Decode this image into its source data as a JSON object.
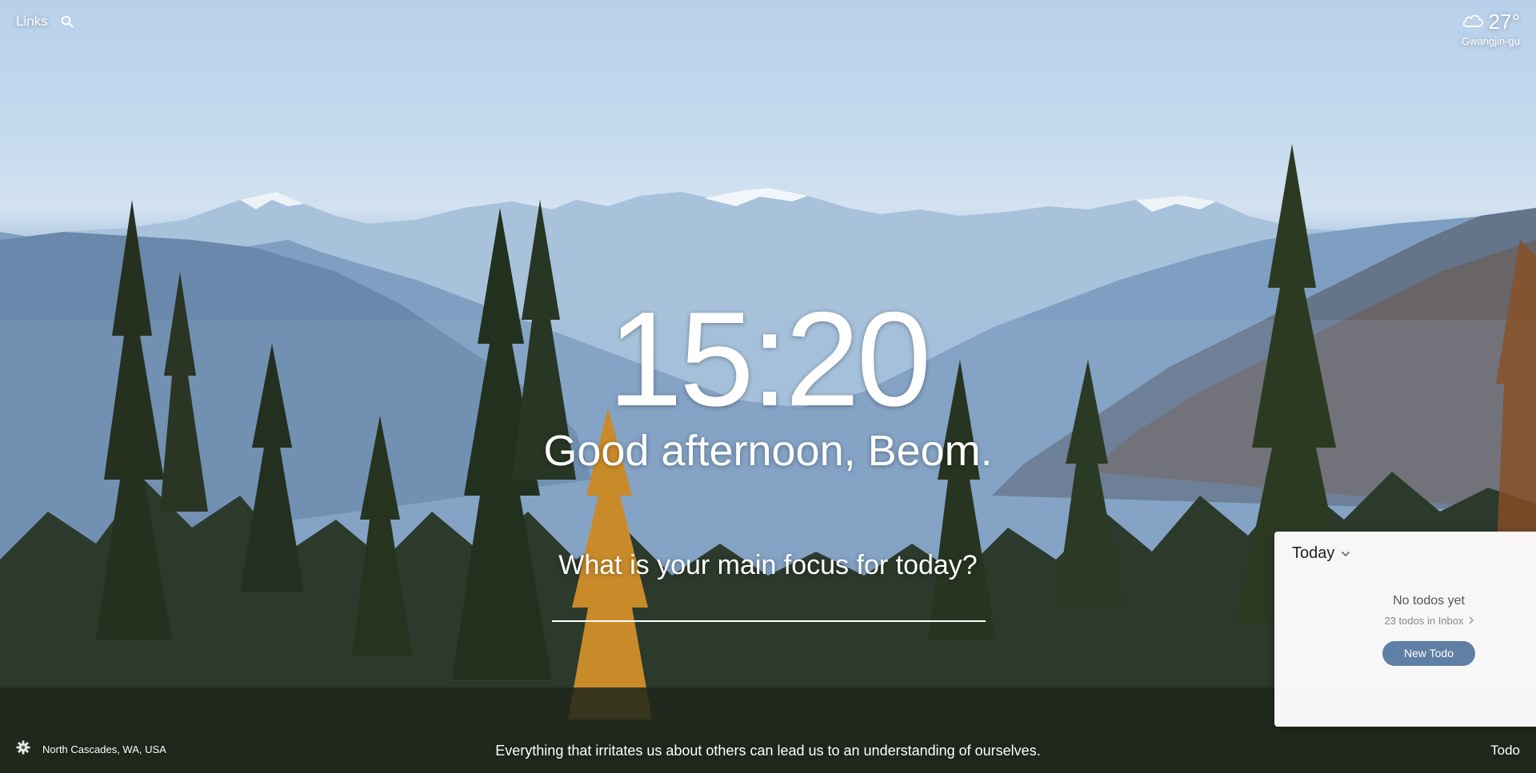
{
  "top_left": {
    "links_label": "Links"
  },
  "weather": {
    "temperature": "27°",
    "location": "Gwangjin-gu",
    "condition_icon": "cloud-icon"
  },
  "clock": {
    "time": "15:20"
  },
  "greeting": "Good afternoon, Beom.",
  "focus": {
    "prompt": "What is your main focus for today?",
    "value": ""
  },
  "bottom": {
    "photo_location": "North Cascades, WA, USA",
    "quote": "Everything that irritates us about others can lead us to an understanding of ourselves.",
    "todo_toggle_label": "Todo"
  },
  "todo_panel": {
    "list_title": "Today",
    "empty_title": "No todos yet",
    "inbox_text": "23 todos in Inbox",
    "new_todo_label": "New Todo"
  },
  "colors": {
    "accent_button": "#5f7fa5"
  }
}
